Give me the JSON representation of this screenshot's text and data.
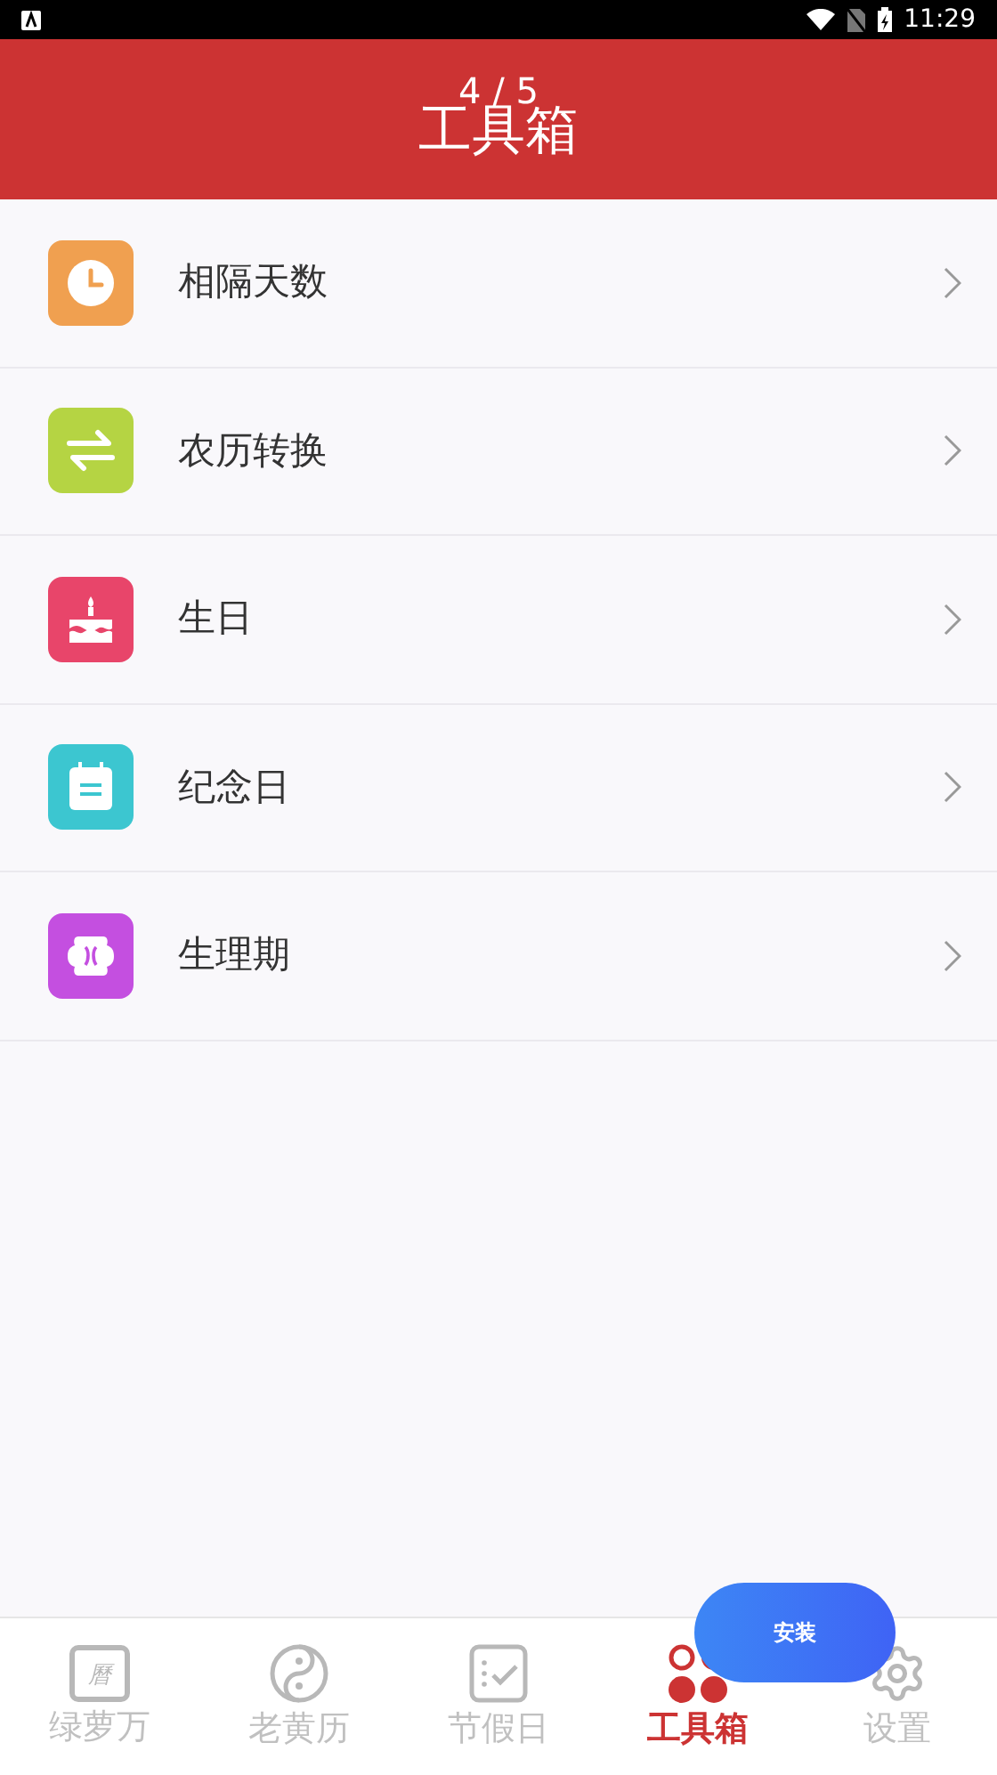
{
  "status_bar": {
    "time": "11:29"
  },
  "header": {
    "title": "工具箱",
    "page_indicator": "4 / 5"
  },
  "tools": [
    {
      "label": "相隔天数",
      "kind": "clock",
      "color": "#f0a050"
    },
    {
      "label": "农历转换",
      "kind": "swap",
      "color": "#b5d443"
    },
    {
      "label": "生日",
      "kind": "cake",
      "color": "#e8456a"
    },
    {
      "label": "纪念日",
      "kind": "calendar",
      "color": "#3cc6d0"
    },
    {
      "label": "生理期",
      "kind": "flower",
      "color": "#c44fe0"
    }
  ],
  "install_button": {
    "label": "安装"
  },
  "bottom_nav": [
    {
      "label": "绿萝万",
      "kind": "almanac",
      "icon_char": "曆",
      "selected": false
    },
    {
      "label": "老黄历",
      "kind": "yinyang",
      "selected": false
    },
    {
      "label": "节假日",
      "kind": "checklist",
      "selected": false
    },
    {
      "label": "工具箱",
      "kind": "dots",
      "selected": true
    },
    {
      "label": "设置",
      "kind": "gear",
      "selected": false
    }
  ]
}
